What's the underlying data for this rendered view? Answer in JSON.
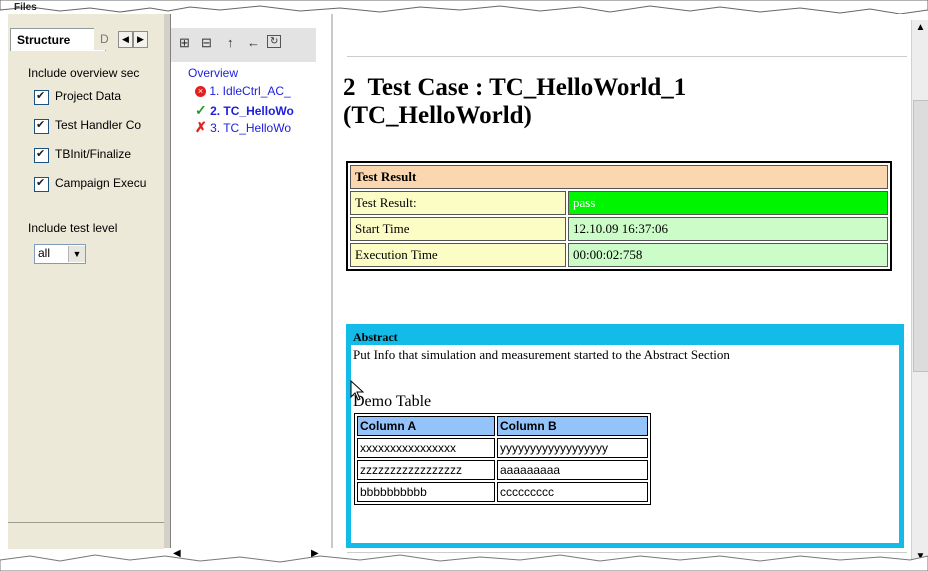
{
  "left_panel": {
    "header_fragment": "Files",
    "tabs": [
      "Structure",
      "D"
    ],
    "overview_label": "Include overview sec",
    "overview_items": [
      {
        "label": "Project Data",
        "checked": true
      },
      {
        "label": "Test Handler Co",
        "checked": true
      },
      {
        "label": "TBInit/Finalize",
        "checked": true
      },
      {
        "label": "Campaign Execu",
        "checked": true
      }
    ],
    "test_level_label": "Include test level",
    "test_level_value": "all"
  },
  "tree": {
    "root": "Overview",
    "items": [
      {
        "label": "1. IdleCtrl_AC_",
        "status": "error",
        "icon": "error-circle-icon"
      },
      {
        "label": "2. TC_HelloWo",
        "status": "pass",
        "icon": "check-icon"
      },
      {
        "label": "3. TC_HelloWo",
        "status": "fail",
        "icon": "x-icon"
      }
    ]
  },
  "report": {
    "title_line1": "2  Test Case : TC_HelloWorld_1",
    "title_line2": "(TC_HelloWorld)",
    "result": {
      "header": "Test Result",
      "rows": [
        {
          "label": "Test Result:",
          "value": "pass"
        },
        {
          "label": "Start Time",
          "value": "12.10.09 16:37:06"
        },
        {
          "label": "Execution Time",
          "value": "00:00:02:758"
        }
      ]
    },
    "abstract": {
      "header": "Abstract",
      "text": "Put Info that simulation and measurement started to the Abstract Section",
      "demo_title": "Demo Table",
      "columns": [
        "Column A",
        "Column B"
      ],
      "rows": [
        [
          "xxxxxxxxxxxxxxxx",
          "yyyyyyyyyyyyyyyyyy"
        ],
        [
          "zzzzzzzzzzzzzzzzz",
          "aaaaaaaaa"
        ],
        [
          "bbbbbbbbbb",
          "ccccccccc"
        ]
      ]
    }
  },
  "colors": {
    "pass_green": "#00f500",
    "value_green": "#ccfcc8",
    "label_yellow": "#fcfcc5",
    "header_orange": "#fad7ae",
    "abstract_blue": "#12bbe8",
    "column_blue": "#93c3f8",
    "link_blue": "#1d1de0",
    "error_red": "#e32020",
    "check_green": "#2a9a2a"
  }
}
